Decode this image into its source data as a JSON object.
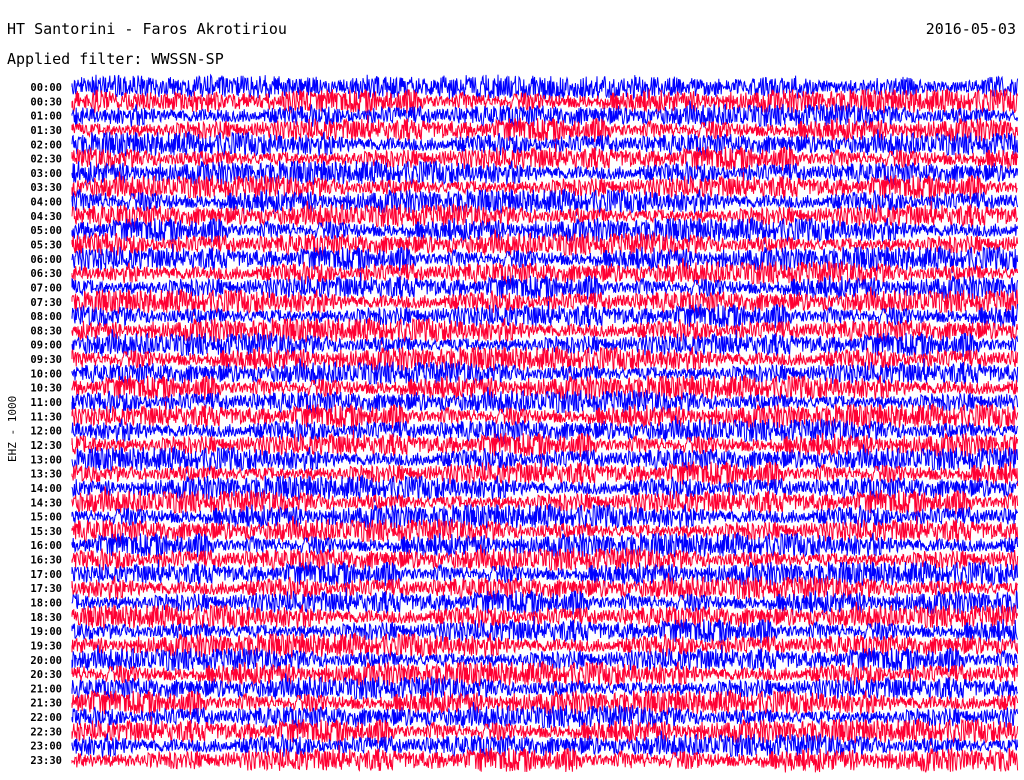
{
  "header": {
    "title": "HT Santorini - Faros Akrotiriou",
    "date": "2016-05-03",
    "filter": "Applied filter: WWSSN-SP"
  },
  "chart_data": {
    "type": "line",
    "subtype": "helicorder",
    "title": "HT Santorini - Faros Akrotiriou",
    "ylabel": "EHZ - 1000",
    "xlabel": "",
    "row_labels": [
      "00:00",
      "00:30",
      "01:00",
      "01:30",
      "02:00",
      "02:30",
      "03:00",
      "03:30",
      "04:00",
      "04:30",
      "05:00",
      "05:30",
      "06:00",
      "06:30",
      "07:00",
      "07:30",
      "08:00",
      "08:30",
      "09:00",
      "09:30",
      "10:00",
      "10:30",
      "11:00",
      "11:30",
      "12:00",
      "12:30",
      "13:00",
      "13:30",
      "14:00",
      "14:30",
      "15:00",
      "15:30",
      "16:00",
      "16:30",
      "17:00",
      "17:30",
      "18:00",
      "18:30",
      "19:00",
      "19:30",
      "20:00",
      "20:30",
      "21:00",
      "21:30",
      "22:00",
      "22:30",
      "23:00",
      "23:30"
    ],
    "row_minutes": 30,
    "series_colors": [
      "#0000ff",
      "#ff0033"
    ],
    "grid": false
  }
}
